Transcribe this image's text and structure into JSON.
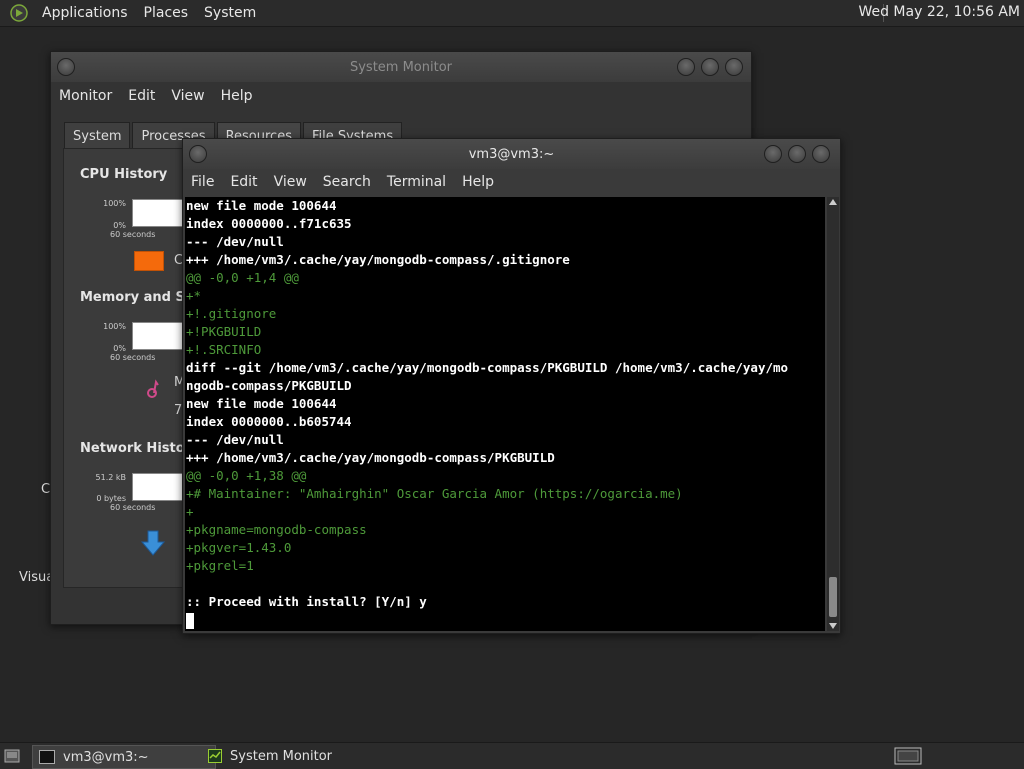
{
  "top_panel": {
    "menus": [
      "Applications",
      "Places",
      "System"
    ],
    "clock": "Wed May 22, 10:56 AM"
  },
  "desktop": {
    "partial_text_1": "C",
    "partial_text_2": "Visua"
  },
  "system_monitor": {
    "title": "System Monitor",
    "menus": [
      "Monitor",
      "Edit",
      "View",
      "Help"
    ],
    "tabs": [
      "System",
      "Processes",
      "Resources",
      "File Systems"
    ],
    "active_tab": "Resources",
    "cpu": {
      "heading": "CPU History",
      "y_max": "100%",
      "y_min": "0%",
      "x_label": "60 seconds",
      "legend_partial": "C"
    },
    "memory": {
      "heading": "Memory and Swa",
      "y_max": "100%",
      "y_min": "0%",
      "x_label": "60 seconds",
      "legend_partial_1": "M",
      "legend_partial_2": "7"
    },
    "network": {
      "heading": "Network History",
      "y_max": "51.2 kB",
      "y_min": "0 bytes",
      "x_label": "60 seconds"
    },
    "colors": {
      "cpu": "#f46a0c"
    }
  },
  "terminal": {
    "title": "vm3@vm3:~",
    "menus": [
      "File",
      "Edit",
      "View",
      "Search",
      "Terminal",
      "Help"
    ],
    "lines": [
      {
        "text": "new file mode 100644",
        "style": "w"
      },
      {
        "text": "index 0000000..f71c635",
        "style": "w"
      },
      {
        "text": "--- /dev/null",
        "style": "w"
      },
      {
        "text": "+++ /home/vm3/.cache/yay/mongodb-compass/.gitignore",
        "style": "w"
      },
      {
        "text": "@@ -0,0 +1,4 @@",
        "style": "g"
      },
      {
        "text": "+*",
        "style": "g"
      },
      {
        "text": "+!.gitignore",
        "style": "g"
      },
      {
        "text": "+!PKGBUILD",
        "style": "g"
      },
      {
        "text": "+!.SRCINFO",
        "style": "g"
      },
      {
        "text": "diff --git /home/vm3/.cache/yay/mongodb-compass/PKGBUILD /home/vm3/.cache/yay/mo",
        "style": "w"
      },
      {
        "text": "ngodb-compass/PKGBUILD",
        "style": "w"
      },
      {
        "text": "new file mode 100644",
        "style": "w"
      },
      {
        "text": "index 0000000..b605744",
        "style": "w"
      },
      {
        "text": "--- /dev/null",
        "style": "w"
      },
      {
        "text": "+++ /home/vm3/.cache/yay/mongodb-compass/PKGBUILD",
        "style": "w"
      },
      {
        "text": "@@ -0,0 +1,38 @@",
        "style": "g"
      },
      {
        "text": "+# Maintainer: \"Amhairghin\" Oscar Garcia Amor (https://ogarcia.me)",
        "style": "g"
      },
      {
        "text": "+",
        "style": "g"
      },
      {
        "text": "+pkgname=mongodb-compass",
        "style": "g"
      },
      {
        "text": "+pkgver=1.43.0",
        "style": "g"
      },
      {
        "text": "+pkgrel=1",
        "style": "g"
      },
      {
        "text": "",
        "style": "w"
      },
      {
        "text": ":: Proceed with install? [Y/n] y",
        "style": "w"
      }
    ]
  },
  "taskbar": {
    "items": [
      "vm3@vm3:~",
      "System Monitor"
    ],
    "active": "vm3@vm3:~"
  }
}
